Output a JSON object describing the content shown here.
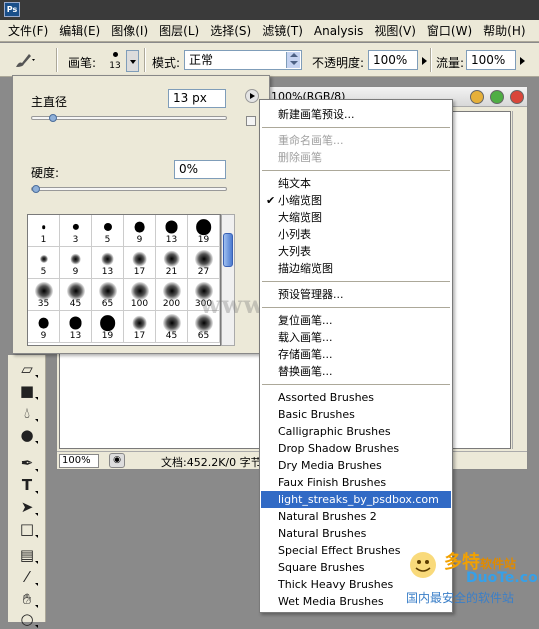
{
  "app": {
    "logo_text": "Ps"
  },
  "menubar": {
    "items": [
      "文件(F)",
      "编辑(E)",
      "图像(I)",
      "图层(L)",
      "选择(S)",
      "滤镜(T)",
      "Analysis",
      "视图(V)",
      "窗口(W)",
      "帮助(H)"
    ]
  },
  "options": {
    "brush_label": "画笔:",
    "brush_size": "13",
    "mode_label": "模式:",
    "mode_value": "正常",
    "opacity_label": "不透明度:",
    "opacity_value": "100%",
    "flow_label": "流量:",
    "flow_value": "100%"
  },
  "brush_picker": {
    "diameter_label": "主直径",
    "diameter_value": "13 px",
    "diameter_fraction": 0.05,
    "hardness_label": "硬度:",
    "hardness_value": "0%",
    "hardness_fraction": 0.0,
    "presets": [
      {
        "size": "1",
        "style": "hard"
      },
      {
        "size": "3",
        "style": "hard"
      },
      {
        "size": "5",
        "style": "hard"
      },
      {
        "size": "9",
        "style": "hard"
      },
      {
        "size": "13",
        "style": "hard"
      },
      {
        "size": "19",
        "style": "hard"
      },
      {
        "size": "5",
        "style": "soft"
      },
      {
        "size": "9",
        "style": "soft"
      },
      {
        "size": "13",
        "style": "soft"
      },
      {
        "size": "17",
        "style": "soft"
      },
      {
        "size": "21",
        "style": "soft"
      },
      {
        "size": "27",
        "style": "soft"
      },
      {
        "size": "35",
        "style": "soft"
      },
      {
        "size": "45",
        "style": "soft"
      },
      {
        "size": "65",
        "style": "soft"
      },
      {
        "size": "100",
        "style": "soft"
      },
      {
        "size": "200",
        "style": "soft"
      },
      {
        "size": "300",
        "style": "soft"
      },
      {
        "size": "9",
        "style": "hard"
      },
      {
        "size": "13",
        "style": "hard"
      },
      {
        "size": "19",
        "style": "hard"
      },
      {
        "size": "17",
        "style": "soft"
      },
      {
        "size": "45",
        "style": "soft"
      },
      {
        "size": "65",
        "style": "soft"
      }
    ]
  },
  "document": {
    "title": "100%(RGB/8)",
    "zoom": "100%",
    "status": "文档:452.2K/0 字节"
  },
  "context_menu": {
    "groups": [
      [
        {
          "label": "新建画笔预设...",
          "enabled": true
        }
      ],
      [
        {
          "label": "重命名画笔...",
          "enabled": false
        },
        {
          "label": "删除画笔",
          "enabled": false
        }
      ],
      [
        {
          "label": "纯文本",
          "enabled": true
        },
        {
          "label": "小缩览图",
          "enabled": true,
          "checked": true
        },
        {
          "label": "大缩览图",
          "enabled": true
        },
        {
          "label": "小列表",
          "enabled": true
        },
        {
          "label": "大列表",
          "enabled": true
        },
        {
          "label": "描边缩览图",
          "enabled": true
        }
      ],
      [
        {
          "label": "预设管理器...",
          "enabled": true
        }
      ],
      [
        {
          "label": "复位画笔...",
          "enabled": true
        },
        {
          "label": "载入画笔...",
          "enabled": true
        },
        {
          "label": "存储画笔...",
          "enabled": true
        },
        {
          "label": "替换画笔...",
          "enabled": true
        }
      ],
      [
        {
          "label": "Assorted Brushes",
          "enabled": true
        },
        {
          "label": "Basic Brushes",
          "enabled": true
        },
        {
          "label": "Calligraphic Brushes",
          "enabled": true
        },
        {
          "label": "Drop Shadow Brushes",
          "enabled": true
        },
        {
          "label": "Dry Media Brushes",
          "enabled": true
        },
        {
          "label": "Faux Finish Brushes",
          "enabled": true
        },
        {
          "label": "light_streaks_by_psdbox.com",
          "enabled": true,
          "selected": true
        },
        {
          "label": "Natural Brushes 2",
          "enabled": true
        },
        {
          "label": "Natural Brushes",
          "enabled": true
        },
        {
          "label": "Special Effect Brushes",
          "enabled": true
        },
        {
          "label": "Square Brushes",
          "enabled": true
        },
        {
          "label": "Thick Heavy Brushes",
          "enabled": true
        },
        {
          "label": "Wet Media Brushes",
          "enabled": true
        }
      ]
    ]
  },
  "toolbox": {
    "tools": [
      "eraser-icon",
      "gradient-icon",
      "blur-icon",
      "dodge-icon",
      "pen-icon",
      "type-icon",
      "path-select-icon",
      "shape-icon",
      "notes-icon",
      "eyedropper-icon",
      "hand-icon",
      "zoom-icon"
    ]
  },
  "watermark": {
    "center": "www.DuoTe.com",
    "logo_cn": "多特",
    "logo_cn_small": "软件站",
    "logo_en": "DuoTe.com",
    "slogan": "国内最安全的软件站"
  },
  "colors": {
    "selection": "#316ac5",
    "window_close": "#d9463a",
    "window_min": "#e6b03a",
    "window_max": "#4fae44"
  }
}
